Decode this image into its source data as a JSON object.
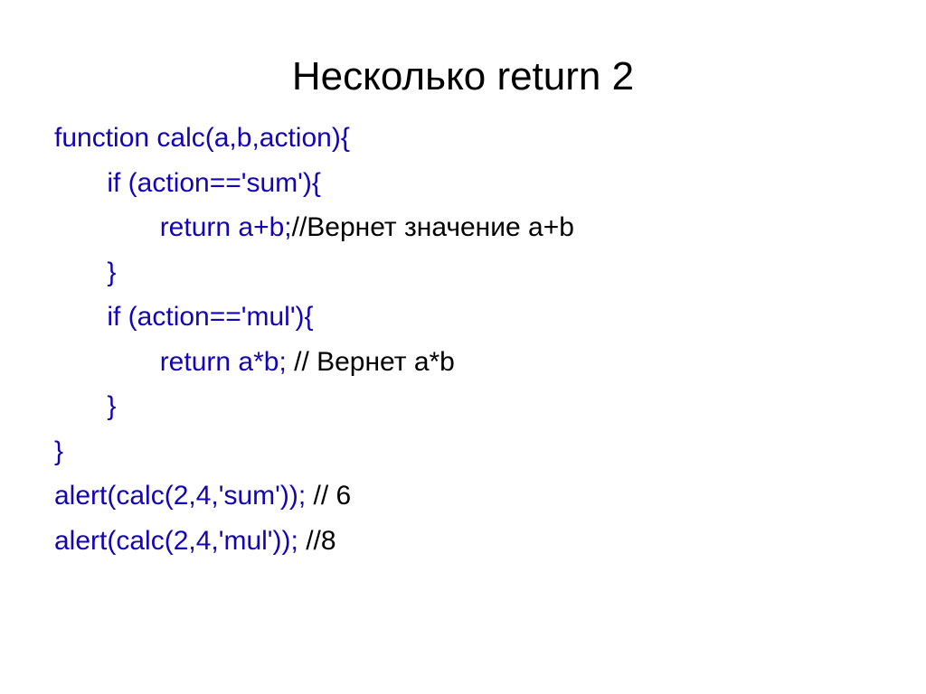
{
  "title": "Несколько return 2",
  "code": {
    "l1": "function calc(a,b,action){",
    "l2": "       if (action=='sum'){",
    "l3a": "              return a+b;",
    "l3b": "//Вернет значение a+b",
    "l4": "       }",
    "l5": "       if (action=='mul'){",
    "l6a": "              return a*b; ",
    "l6b": "// Вернет a*b",
    "l7": "       }",
    "l8": "}",
    "l9a": "alert(calc(2,4,'sum')); ",
    "l9b": "// 6",
    "l10a": "alert(calc(2,4,'mul')); ",
    "l10b": "//8"
  }
}
